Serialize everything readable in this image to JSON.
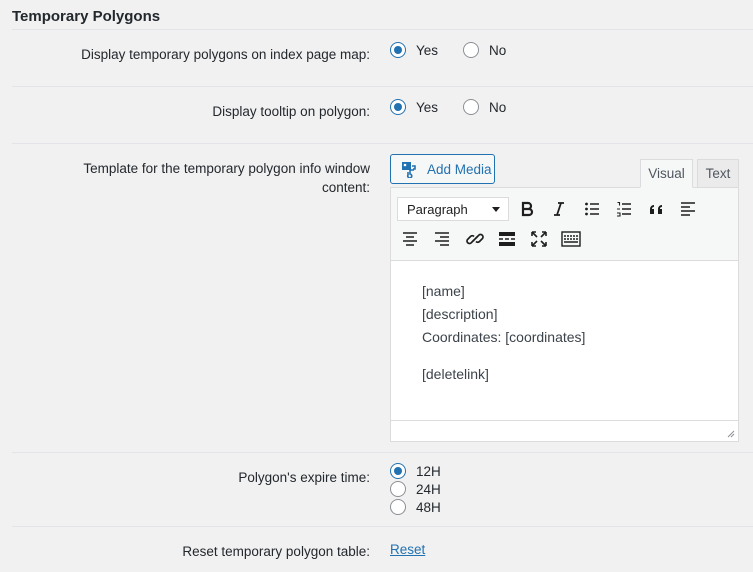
{
  "section": {
    "title": "Temporary Polygons"
  },
  "rows": {
    "display_map": {
      "label": "Display temporary polygons on index page map:",
      "options": [
        {
          "label": "Yes",
          "checked": true
        },
        {
          "label": "No",
          "checked": false
        }
      ]
    },
    "tooltip": {
      "label": "Display tooltip on polygon:",
      "options": [
        {
          "label": "Yes",
          "checked": true
        },
        {
          "label": "No",
          "checked": false
        }
      ]
    },
    "template": {
      "label_line1": "Template for the temporary polygon info window",
      "label_line2": "content:"
    },
    "expire": {
      "label": "Polygon's expire time:",
      "options": [
        {
          "label": "12H",
          "checked": true
        },
        {
          "label": "24H",
          "checked": false
        },
        {
          "label": "48H",
          "checked": false
        }
      ]
    },
    "reset": {
      "label": "Reset temporary polygon table:",
      "link": "Reset"
    }
  },
  "editor": {
    "add_media_label": "Add Media",
    "tabs": {
      "visual": "Visual",
      "text": "Text"
    },
    "format_select": "Paragraph",
    "content": {
      "line1": "[name]",
      "line2": "[description]",
      "line3": "Coordinates: [coordinates]",
      "line4": "[deletelink]"
    },
    "toolbar_icons": [
      "bold-icon",
      "italic-icon",
      "bulleted-list-icon",
      "numbered-list-icon",
      "blockquote-icon",
      "align-left-icon",
      "align-center-icon",
      "align-right-icon",
      "link-icon",
      "read-more-icon",
      "fullscreen-icon",
      "toolbar-toggle-icon"
    ]
  },
  "colors": {
    "accent": "#2271b1",
    "background": "#f1f1f1",
    "text": "#23282d",
    "border": "#dcdcde"
  }
}
